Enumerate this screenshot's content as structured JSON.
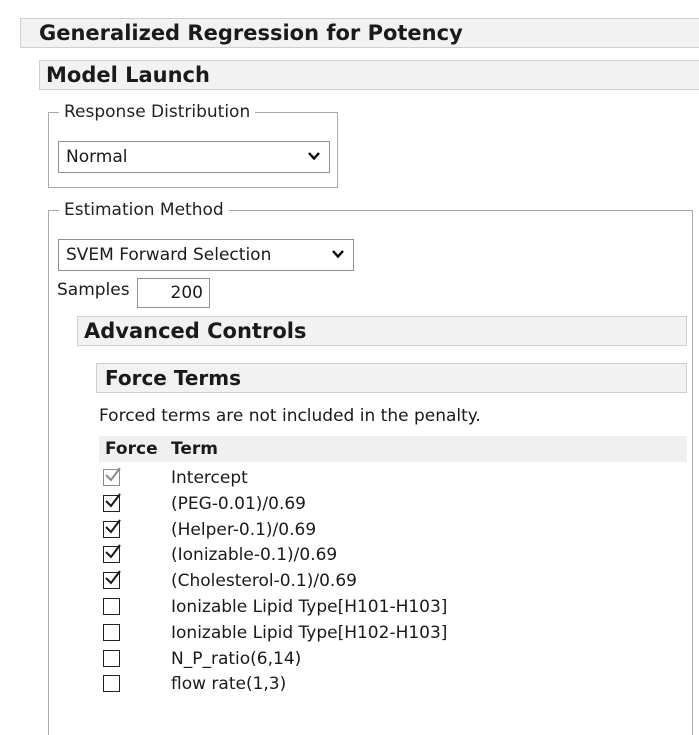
{
  "report": {
    "title": "Generalized Regression for Potency"
  },
  "model_launch": {
    "title": "Model Launch"
  },
  "response_distribution": {
    "legend": "Response Distribution",
    "selected": "Normal"
  },
  "estimation_method": {
    "legend": "Estimation Method",
    "selected": "SVEM Forward Selection",
    "samples_label": "Samples",
    "samples_value": "200"
  },
  "advanced_controls": {
    "title": "Advanced Controls"
  },
  "force_terms": {
    "title": "Force Terms",
    "note": "Forced terms are not included in the penalty.",
    "col_force": "Force",
    "col_term": "Term",
    "rows": [
      {
        "term": "Intercept",
        "checked": true,
        "disabled": true
      },
      {
        "term": "(PEG-0.01)/0.69",
        "checked": true,
        "disabled": false
      },
      {
        "term": "(Helper-0.1)/0.69",
        "checked": true,
        "disabled": false
      },
      {
        "term": "(Ionizable-0.1)/0.69",
        "checked": true,
        "disabled": false
      },
      {
        "term": "(Cholesterol-0.1)/0.69",
        "checked": true,
        "disabled": false
      },
      {
        "term": "Ionizable Lipid Type[H101-H103]",
        "checked": false,
        "disabled": false
      },
      {
        "term": "Ionizable Lipid Type[H102-H103]",
        "checked": false,
        "disabled": false
      },
      {
        "term": "N_P_ratio(6,14)",
        "checked": false,
        "disabled": false
      },
      {
        "term": "flow rate(1,3)",
        "checked": false,
        "disabled": false
      }
    ]
  },
  "colors": {
    "header_bg": "#f2f2f2",
    "border": "#cfcfcf",
    "check": "#1a1a1a",
    "check_disabled": "#8a8a8a"
  }
}
